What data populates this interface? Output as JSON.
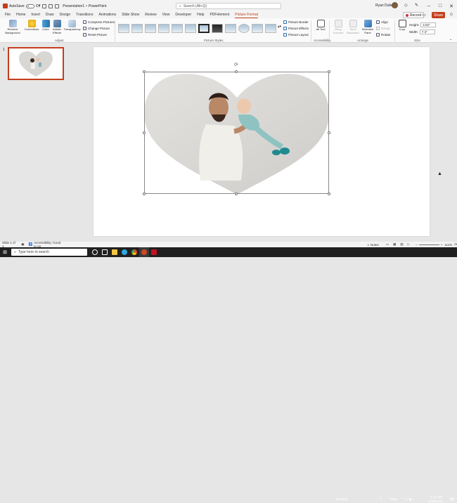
{
  "titlebar": {
    "autosave": "AutoSave",
    "toggle": "Off",
    "filename": "Presentation1",
    "sep": "•",
    "app": "PowerPoint",
    "search_placeholder": "Search (Alt+Q)",
    "user": "Ryan Dube",
    "minimize": "–",
    "maximize": "□",
    "close": "✕"
  },
  "menu": {
    "tabs": [
      "File",
      "Home",
      "Insert",
      "Draw",
      "Design",
      "Transitions",
      "Animations",
      "Slide Show",
      "Review",
      "View",
      "Developer",
      "Help",
      "PDFelement",
      "Picture Format"
    ],
    "record": "Record",
    "share": "Share"
  },
  "ribbon": {
    "remove_bg": "Remove Background",
    "corrections": "Corrections",
    "color": "Color",
    "artistic": "Artistic Effects",
    "transparency": "Transparency",
    "compress": "Compress Pictures",
    "change": "Change Picture",
    "reset": "Reset Picture",
    "adjust": "Adjust",
    "picture_styles": "Picture Styles",
    "border": "Picture Border",
    "effects": "Picture Effects",
    "layout": "Picture Layout",
    "alt_text": "Alt Text",
    "accessibility": "Accessibility",
    "bring_forward": "Bring Forward",
    "send_backward": "Send Backward",
    "selection_pane": "Selection Pane",
    "align": "Align",
    "group": "Group",
    "rotate": "Rotate",
    "arrange": "Arrange",
    "crop": "Crop",
    "height_label": "Height:",
    "height_value": "4.02\"",
    "width_label": "Width:",
    "width_value": "7.3\"",
    "size": "Size"
  },
  "slides": {
    "number": "1"
  },
  "status": {
    "slide_of": "Slide 1 of 1",
    "accessibility": "Accessibility: Good to go",
    "notes": "Notes",
    "zoom": "111%"
  },
  "taskbar": {
    "search_placeholder": "Type here to search",
    "desktop": "Desktop",
    "weather": "Clear",
    "time": "1:34 PM",
    "date": "11/28/2021"
  }
}
